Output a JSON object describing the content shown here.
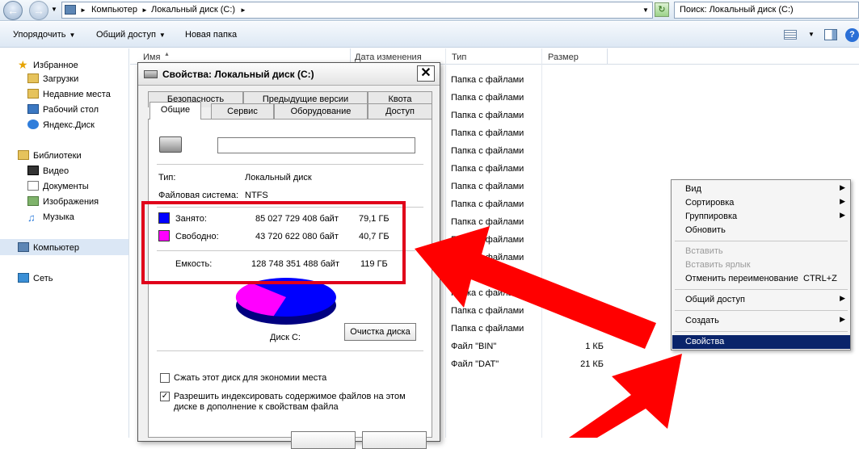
{
  "address": {
    "crumbs": [
      "Компьютер",
      "Локальный диск (C:)"
    ],
    "search_placeholder": "Поиск: Локальный диск (C:)"
  },
  "toolbar": {
    "organize": "Упорядочить",
    "share": "Общий доступ",
    "new_folder": "Новая папка"
  },
  "sidebar": {
    "favorites": "Избранное",
    "fav_items": [
      "Загрузки",
      "Недавние места",
      "Рабочий стол",
      "Яндекс.Диск"
    ],
    "libraries": "Библиотеки",
    "lib_items": [
      "Видео",
      "Документы",
      "Изображения",
      "Музыка"
    ],
    "computer": "Компьютер",
    "network": "Сеть"
  },
  "file_list": {
    "columns": [
      "Имя",
      "Дата изменения",
      "Тип",
      "Размер"
    ],
    "rows": [
      {
        "type": "Папка с файлами",
        "size": ""
      },
      {
        "type": "Папка с файлами",
        "size": ""
      },
      {
        "type": "Папка с файлами",
        "size": ""
      },
      {
        "type": "Папка с файлами",
        "size": ""
      },
      {
        "type": "Папка с файлами",
        "size": ""
      },
      {
        "type": "Папка с файлами",
        "size": ""
      },
      {
        "type": "Папка с файлами",
        "size": ""
      },
      {
        "type": "Папка с файлами",
        "size": ""
      },
      {
        "type": "Папка с файлами",
        "size": ""
      },
      {
        "type": "Папка с файлами",
        "size": ""
      },
      {
        "type": "Папка с файлами",
        "size": ""
      },
      {
        "type": "Папка с файлами",
        "size": ""
      },
      {
        "type": "Папка с файлами",
        "size": ""
      },
      {
        "type": "Папка с файлами",
        "size": ""
      },
      {
        "type": "Папка с файлами",
        "size": ""
      },
      {
        "type": "Файл \"BIN\"",
        "size": "1 КБ"
      },
      {
        "type": "Файл \"DAT\"",
        "size": "21 КБ"
      }
    ]
  },
  "dialog": {
    "title": "Свойства: Локальный диск (C:)",
    "tabs_row1": [
      "Безопасность",
      "Предыдущие версии",
      "Квота"
    ],
    "tabs_row2": [
      "Общие",
      "Сервис",
      "Оборудование",
      "Доступ"
    ],
    "name_value": "",
    "type_label": "Тип:",
    "type_value": "Локальный диск",
    "fs_label": "Файловая система:",
    "fs_value": "NTFS",
    "used_label": "Занято:",
    "used_bytes": "85 027 729 408 байт",
    "used_gb": "79,1 ГБ",
    "free_label": "Свободно:",
    "free_bytes": "43 720 622 080 байт",
    "free_gb": "40,7 ГБ",
    "capacity_label": "Емкость:",
    "capacity_bytes": "128 748 351 488 байт",
    "capacity_gb": "119 ГБ",
    "used_color": "#0000ff",
    "free_color": "#ff00ff",
    "used_fraction": 0.66,
    "disk_label": "Диск C:",
    "cleanup_button": "Очистка диска",
    "compress_label": "Сжать этот диск для экономии места",
    "compress_checked": false,
    "index_label": "Разрешить индексировать содержимое файлов на этом диске в дополнение к свойствам файла",
    "index_checked": true
  },
  "context_menu": {
    "items": [
      {
        "label": "Вид",
        "submenu": true,
        "disabled": false
      },
      {
        "label": "Сортировка",
        "submenu": true,
        "disabled": false
      },
      {
        "label": "Группировка",
        "submenu": true,
        "disabled": false
      },
      {
        "label": "Обновить",
        "submenu": false,
        "disabled": false
      },
      {
        "label": "Вставить",
        "submenu": false,
        "disabled": true
      },
      {
        "label": "Вставить ярлык",
        "submenu": false,
        "disabled": true
      },
      {
        "label": "Отменить переименование",
        "shortcut": "CTRL+Z",
        "submenu": false,
        "disabled": false
      },
      {
        "label": "Общий доступ",
        "submenu": true,
        "disabled": false
      },
      {
        "label": "Создать",
        "submenu": true,
        "disabled": false
      },
      {
        "label": "Свойства",
        "submenu": false,
        "disabled": false,
        "selected": true
      }
    ]
  },
  "annotation": {
    "highlight_color": "#e0001a",
    "arrow_color": "#ff0000"
  }
}
